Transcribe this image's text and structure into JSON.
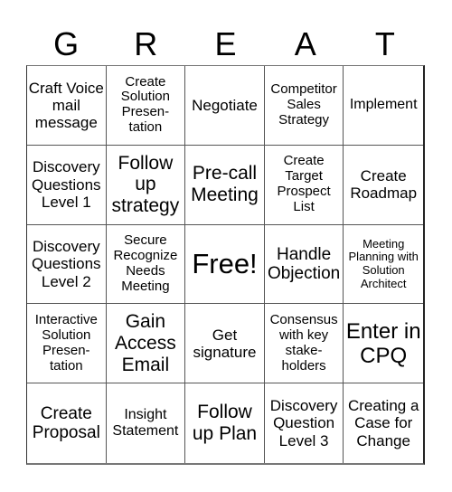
{
  "header": {
    "letters": [
      "G",
      "R",
      "E",
      "A",
      "T"
    ]
  },
  "cells": [
    "Craft Voice mail message",
    "Create Solution Presen- tation",
    "Negotiate",
    "Competitor Sales Strategy",
    "Implement",
    "Discovery Questions Level 1",
    "Follow up strategy",
    "Pre-call Meeting",
    "Create Target Prospect List",
    "Create Roadmap",
    "Discovery Questions Level 2",
    "Secure Recognize Needs Meeting",
    "Free!",
    "Handle Objection",
    "Meeting Planning with Solution Architect",
    "Interactive Solution Presen- tation",
    "Gain Access Email",
    "Get signature",
    "Consensus with key stake- holders",
    "Enter in CPQ",
    "Create Proposal",
    "Insight Statement",
    "Follow up Plan",
    "Discovery Question Level 3",
    "Creating a Case for Change"
  ]
}
